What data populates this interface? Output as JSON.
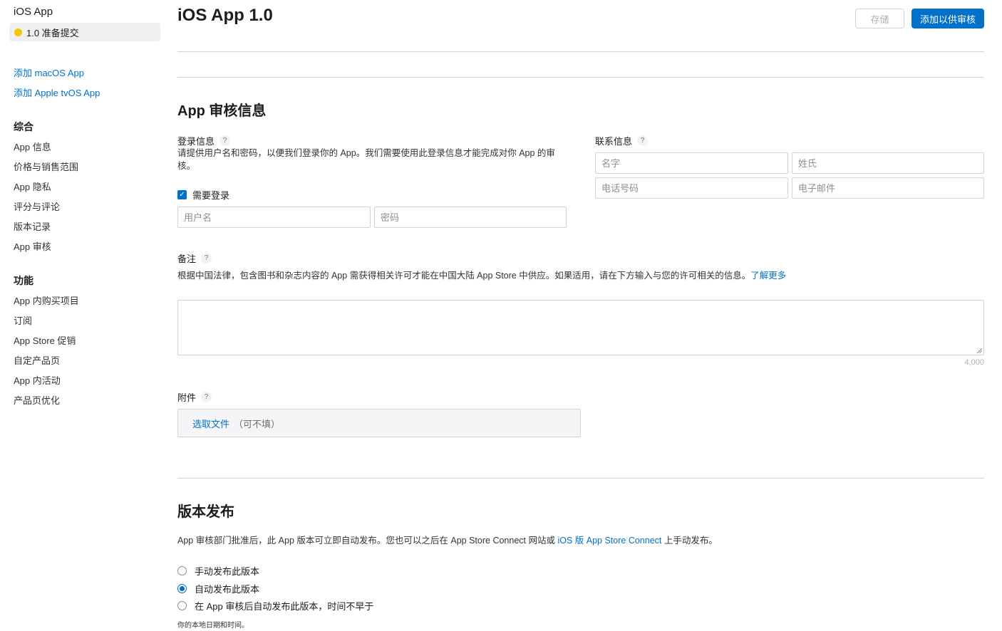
{
  "sidebar": {
    "app_name": "iOS App",
    "version_label": "1.0 准备提交",
    "add_links": [
      "添加 macOS App",
      "添加 Apple tvOS App"
    ],
    "sections": [
      {
        "heading": "综合",
        "items": [
          "App 信息",
          "价格与销售范围",
          "App 隐私",
          "评分与评论",
          "版本记录",
          "App 审核"
        ]
      },
      {
        "heading": "功能",
        "items": [
          "App 内购买项目",
          "订阅",
          "App Store 促销",
          "自定产品页",
          "App 内活动",
          "产品页优化"
        ]
      }
    ],
    "version_dot_color": "#f5c400"
  },
  "header": {
    "title": "iOS App 1.0",
    "save_label": "存储",
    "submit_label": "添加以供审核"
  },
  "review": {
    "section_title": "App 审核信息",
    "login": {
      "label": "登录信息",
      "help": "?",
      "description": "请提供用户名和密码，以便我们登录你的 App。我们需要使用此登录信息才能完成对你 App 的审核。",
      "checkbox_label": "需要登录",
      "checkbox_checked": true,
      "username_placeholder": "用户名",
      "password_placeholder": "密码"
    },
    "contact": {
      "label": "联系信息",
      "help": "?",
      "first_name_placeholder": "名字",
      "last_name_placeholder": "姓氏",
      "phone_placeholder": "电话号码",
      "email_placeholder": "电子邮件"
    },
    "notes": {
      "label": "备注",
      "help": "?",
      "description": "根据中国法律，包含图书和杂志内容的 App 需获得相关许可才能在中国大陆 App Store 中供应。如果适用，请在下方输入与您的许可相关的信息。",
      "learn_more": "了解更多",
      "counter": "4,000"
    },
    "attachment": {
      "label": "附件",
      "help": "?",
      "choose_file": "选取文件",
      "optional": "（可不填）"
    }
  },
  "release": {
    "section_title": "版本发布",
    "description": "App 审核部门批准后，此 App 版本可立即自动发布。您也可以之后在 App Store Connect 网站或",
    "link": "iOS 版 App Store Connect",
    "description_suffix": "上手动发布。",
    "options": [
      {
        "label": "手动发布此版本",
        "checked": false
      },
      {
        "label": "自动发布此版本",
        "checked": true
      },
      {
        "label": "在 App 审核后自动发布此版本，时间不早于",
        "checked": false
      }
    ],
    "note": "你的本地日期和时间。"
  },
  "colors": {
    "accent": "#0070c9",
    "border": "#d2d2d7"
  }
}
